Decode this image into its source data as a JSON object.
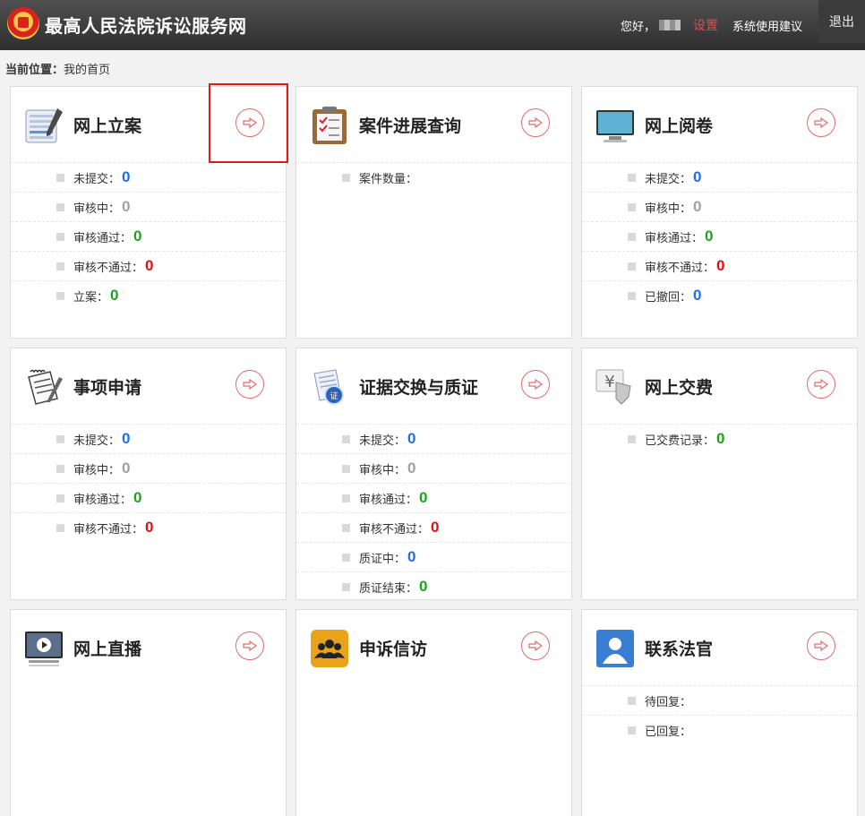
{
  "header": {
    "site_title": "最高人民法院诉讼服务网",
    "greeting": "您好，",
    "settings": "设置",
    "suggestions": "系统使用建议",
    "logout": "退出"
  },
  "breadcrumb": {
    "label": "当前位置：",
    "current": "我的首页"
  },
  "colors": {
    "blue": "#1e6ee8",
    "gray": "#a0a0a0",
    "green": "#1aa51a",
    "red": "#e01010",
    "accent": "#e36a6a"
  },
  "cards": [
    {
      "title": "网上立案",
      "icon": "document-list-icon",
      "rows": [
        {
          "label": "未提交：",
          "value": "0",
          "color": "blue"
        },
        {
          "label": "审核中：",
          "value": "0",
          "color": "gray"
        },
        {
          "label": "审核通过：",
          "value": "0",
          "color": "green"
        },
        {
          "label": "审核不通过：",
          "value": "0",
          "color": "red"
        },
        {
          "label": "立案：",
          "value": "0",
          "color": "green"
        }
      ]
    },
    {
      "title": "案件进展查询",
      "icon": "clipboard-icon",
      "rows": [
        {
          "label": "案件数量：",
          "value": "",
          "color": "blue"
        }
      ]
    },
    {
      "title": "网上阅卷",
      "icon": "monitor-icon",
      "rows": [
        {
          "label": "未提交：",
          "value": "0",
          "color": "blue"
        },
        {
          "label": "审核中：",
          "value": "0",
          "color": "gray"
        },
        {
          "label": "审核通过：",
          "value": "0",
          "color": "green"
        },
        {
          "label": "审核不通过：",
          "value": "0",
          "color": "red"
        },
        {
          "label": "已撤回：",
          "value": "0",
          "color": "blue"
        }
      ]
    },
    {
      "title": "事项申请",
      "icon": "notepad-icon",
      "rows": [
        {
          "label": "未提交：",
          "value": "0",
          "color": "blue"
        },
        {
          "label": "审核中：",
          "value": "0",
          "color": "gray"
        },
        {
          "label": "审核通过：",
          "value": "0",
          "color": "green"
        },
        {
          "label": "审核不通过：",
          "value": "0",
          "color": "red"
        }
      ]
    },
    {
      "title": "证据交换与质证",
      "icon": "certificate-icon",
      "rows": [
        {
          "label": "未提交：",
          "value": "0",
          "color": "blue"
        },
        {
          "label": "审核中：",
          "value": "0",
          "color": "gray"
        },
        {
          "label": "审核通过：",
          "value": "0",
          "color": "green"
        },
        {
          "label": "审核不通过：",
          "value": "0",
          "color": "red"
        },
        {
          "label": "质证中：",
          "value": "0",
          "color": "blue"
        },
        {
          "label": "质证结束：",
          "value": "0",
          "color": "green"
        }
      ]
    },
    {
      "title": "网上交费",
      "icon": "yuan-payment-icon",
      "rows": [
        {
          "label": "已交费记录：",
          "value": "0",
          "color": "green"
        }
      ]
    },
    {
      "title": "网上直播",
      "icon": "video-play-icon",
      "rows": []
    },
    {
      "title": "申诉信访",
      "icon": "people-group-icon",
      "rows": []
    },
    {
      "title": "联系法官",
      "icon": "contact-user-icon",
      "rows": [
        {
          "label": "待回复：",
          "value": "",
          "color": "blue"
        },
        {
          "label": "已回复：",
          "value": "",
          "color": "blue"
        }
      ]
    }
  ]
}
